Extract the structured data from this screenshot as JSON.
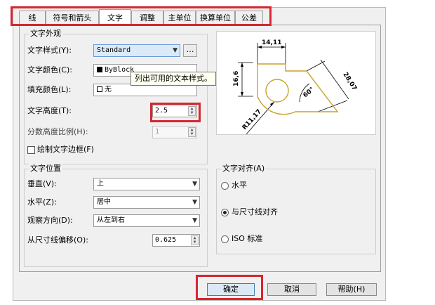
{
  "tabs": [
    {
      "label": "线"
    },
    {
      "label": "符号和箭头"
    },
    {
      "label": "文字"
    },
    {
      "label": "调整"
    },
    {
      "label": "主单位"
    },
    {
      "label": "换算单位"
    },
    {
      "label": "公差"
    }
  ],
  "appearance": {
    "title": "文字外观",
    "style_label": "文字样式(Y):",
    "style_value": "Standard",
    "color_label": "文字颜色(C):",
    "color_value": "ByBlock",
    "fill_label": "填充颜色(L):",
    "fill_value": "无",
    "height_label": "文字高度(T):",
    "height_value": "2.5",
    "fraction_label": "分数高度比例(H):",
    "fraction_value": "1",
    "frame_label": "绘制文字边框(F)"
  },
  "tooltip": "列出可用的文本样式。",
  "placement": {
    "title": "文字位置",
    "vertical_label": "垂直(V):",
    "vertical_value": "上",
    "horizontal_label": "水平(Z):",
    "horizontal_value": "居中",
    "view_label": "观察方向(D):",
    "view_value": "从左到右",
    "offset_label": "从尺寸线偏移(O):",
    "offset_value": "0.625"
  },
  "alignment": {
    "title": "文字对齐(A)",
    "opt_horizontal": "水平",
    "opt_aligned": "与尺寸线对齐",
    "opt_iso": "ISO 标准",
    "selected": "与尺寸线对齐"
  },
  "preview": {
    "dim_top": "14,11",
    "dim_left": "16,6",
    "dim_right": "28,07",
    "dim_angle": "60°",
    "dim_radius": "R11,17"
  },
  "buttons": {
    "ok": "确定",
    "cancel": "取消",
    "help": "帮助(H)"
  },
  "colors": {
    "highlight_red": "#d6272e",
    "shape_gold": "#c9a227"
  }
}
